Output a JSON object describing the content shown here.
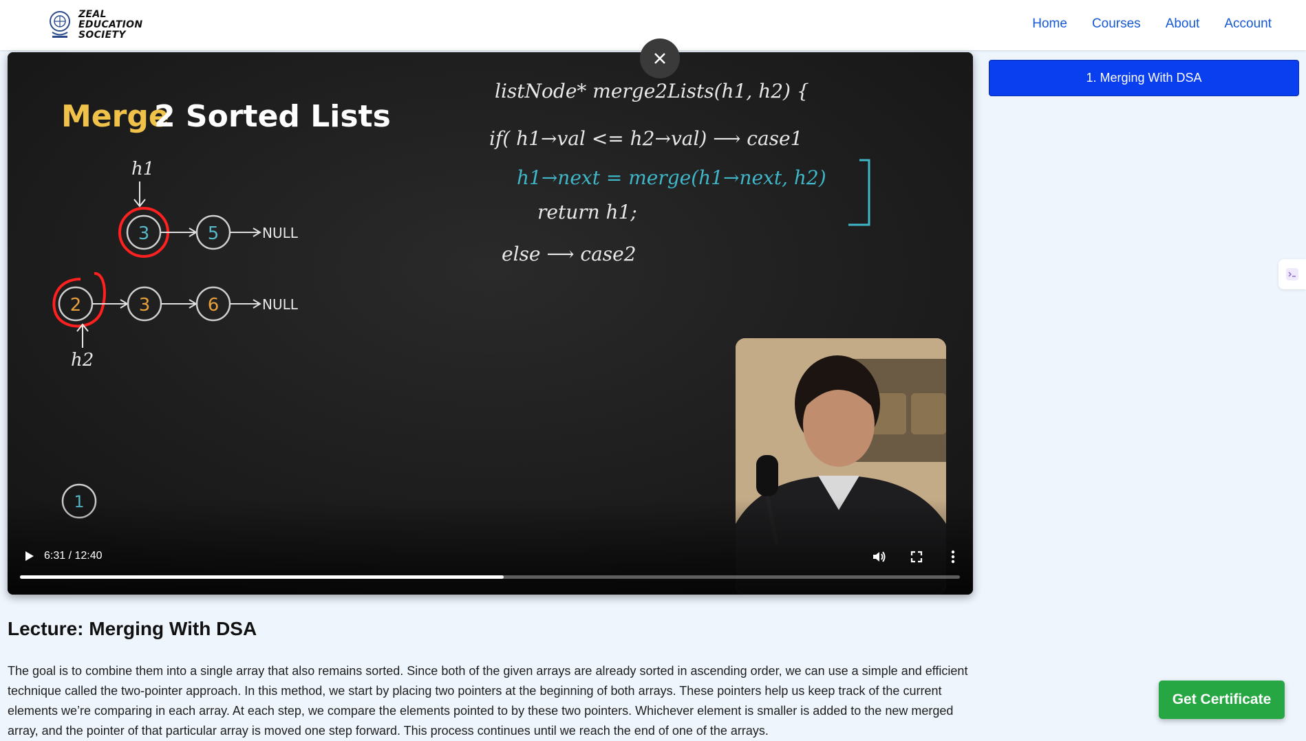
{
  "header": {
    "logo_lines": [
      "ZEAL",
      "EDUCATION",
      "SOCIETY"
    ],
    "nav": [
      "Home",
      "Courses",
      "About",
      "Account"
    ]
  },
  "video": {
    "slide_title_part1": "Merge",
    "slide_title_part2": "2 Sorted Lists",
    "list1_nodes": [
      "3",
      "5"
    ],
    "list2_nodes": [
      "2",
      "3",
      "6"
    ],
    "null_label": "NULL",
    "pointer1_label": "h1",
    "pointer2_label": "h2",
    "code_line1": "listNode* merge2Lists(h1, h2) {",
    "code_line2": "if( h1→val <= h2→val) ⟶ case1",
    "code_line3": "h1→next = merge(h1→next, h2)",
    "code_line4": "return h1;",
    "code_line5": "else ⟶ case2",
    "slide_number": "1",
    "time": "6:31 / 12:40",
    "progress_fraction": 0.515
  },
  "sidebar": {
    "lesson_label": "1. Merging With DSA",
    "side_tab_icon": "code-icon"
  },
  "lecture": {
    "title": "Lecture: Merging With DSA",
    "description": "The goal is to combine them into a single array that also remains sorted. Since both of the given arrays are already sorted in ascending order, we can use a simple and efficient technique called the two-pointer approach. In this method, we start by placing two pointers at the beginning of both arrays. These pointers help us keep track of the current elements we’re comparing in each array. At each step, we compare the elements pointed to by these two pointers. Whichever element is smaller is added to the new merged array, and the pointer of that particular array is moved one step forward. This process continues until we reach the end of one of the arrays."
  },
  "certificate_button": "Get Certificate",
  "colors": {
    "accent_blue": "#0a3ff0",
    "certificate_green": "#27a744",
    "nav_link": "#1558d6"
  }
}
